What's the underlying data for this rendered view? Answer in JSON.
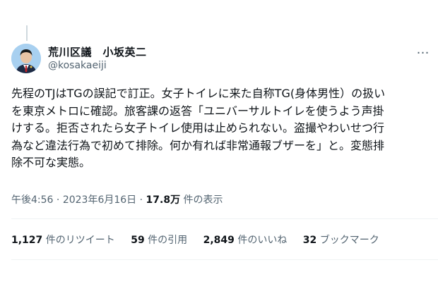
{
  "author": {
    "display_name": "荒川区議　小坂英二",
    "handle": "@kosakaeiji"
  },
  "more_icon": "…",
  "tweet": {
    "lines": [
      "先程のTJはTGの誤記で訂正。女子トイレに来た自称TG(身体男性）の扱い",
      "を東京メトロに確認。旅客課の返答「ユニバーサルトイレを使うよう声掛",
      "けする。拒否されたら女子トイレ使用は止められない。盗撮やわいせつ行",
      "為など違法行為で初めて排除。何か有れば非常通報ブザーを」と。変態排",
      "除不可な実態。"
    ]
  },
  "meta": {
    "time": "午後4:56",
    "sep1": " · ",
    "date": "2023年6月16日",
    "sep2": " · ",
    "views_count": "17.8万",
    "views_label": " 件の表示"
  },
  "stats": [
    {
      "count": "1,127",
      "label": "件のリツイート"
    },
    {
      "count": "59",
      "label": "件の引用"
    },
    {
      "count": "2,849",
      "label": "件のいいね"
    },
    {
      "count": "32",
      "label": "ブックマーク"
    }
  ]
}
